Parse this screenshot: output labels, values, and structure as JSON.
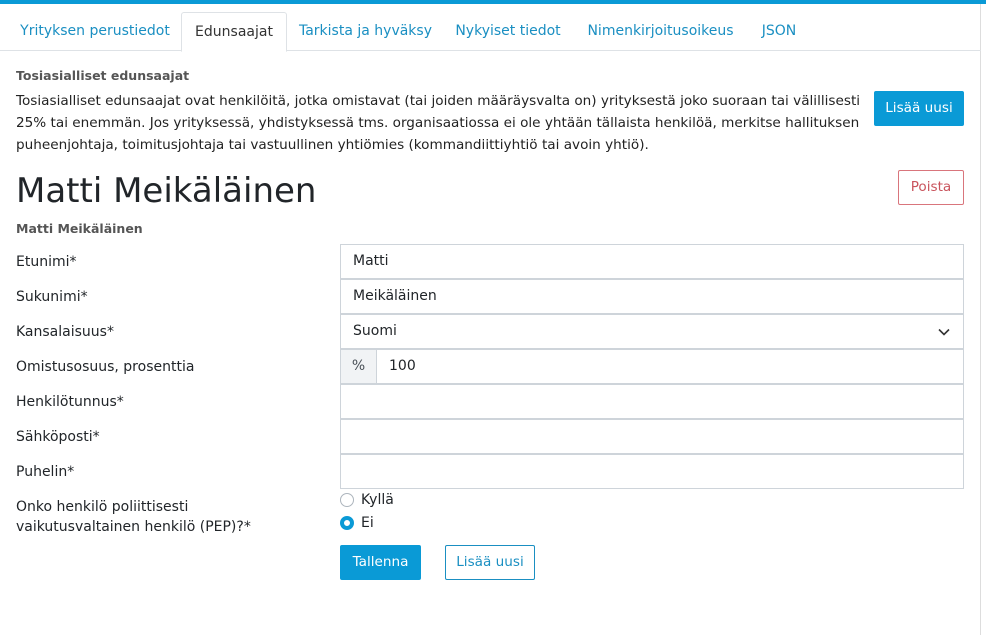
{
  "tabs": [
    {
      "label": "Yrityksen perustiedot",
      "active": false
    },
    {
      "label": "Edunsaajat",
      "active": true
    },
    {
      "label": "Tarkista ja hyväksy",
      "active": false
    },
    {
      "label": "Nykyiset tiedot",
      "active": false
    },
    {
      "label": "Nimenkirjoitusoikeus",
      "active": false
    },
    {
      "label": "JSON",
      "active": false
    }
  ],
  "section": {
    "label": "Tosiasialliset edunsaajat",
    "intro": "Tosiasialliset edunsaajat ovat henkilöitä, jotka omistavat (tai joiden määräysvalta on) yrityksestä joko suoraan tai välillisesti 25% tai enemmän. Jos yrityksessä, yhdistyksessä tms. organisaatiossa ei ole yhtään tällaista henkilöä, merkitse hallituksen puheenjohtaja, toimitusjohtaja tai vastuullinen yhtiömies (kommandiittiyhtiö tai avoin yhtiö).",
    "add_new_label": "Lisää uusi"
  },
  "person": {
    "title": "Matti Meikäläinen",
    "subtitle": "Matti Meikäläinen",
    "delete_label": "Poista"
  },
  "form": {
    "first_name": {
      "label": "Etunimi*",
      "value": "Matti"
    },
    "last_name": {
      "label": "Sukunimi*",
      "value": "Meikäläinen"
    },
    "nationality": {
      "label": "Kansalaisuus*",
      "value": "Suomi"
    },
    "ownership": {
      "label": "Omistusosuus, prosenttia",
      "prefix": "%",
      "value": "100"
    },
    "ssn": {
      "label": "Henkilötunnus*",
      "value": ""
    },
    "email": {
      "label": "Sähköposti*",
      "value": ""
    },
    "phone": {
      "label": "Puhelin*",
      "value": ""
    },
    "pep": {
      "label": "Onko henkilö poliittisesti vaikutusvaltainen henkilö (PEP)?*",
      "options": [
        {
          "label": "Kyllä",
          "checked": false
        },
        {
          "label": "Ei",
          "checked": true
        }
      ]
    },
    "save_label": "Tallenna",
    "add_new_label": "Lisää uusi"
  },
  "colors": {
    "accent": "#0a9ad6",
    "link": "#1a8fc2",
    "danger": "#c9545d"
  },
  "icons": {
    "select_chevron": "chevron-down-icon"
  }
}
